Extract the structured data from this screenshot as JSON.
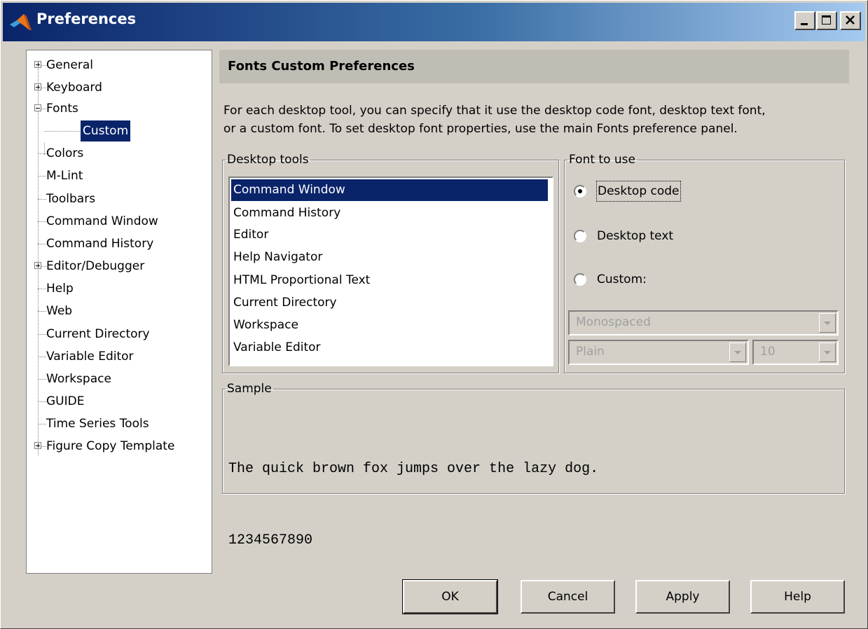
{
  "window": {
    "title": "Preferences"
  },
  "tree": {
    "items": [
      {
        "label": "General"
      },
      {
        "label": "Keyboard"
      },
      {
        "label": "Fonts"
      },
      {
        "label": "Custom"
      },
      {
        "label": "Colors"
      },
      {
        "label": "M-Lint"
      },
      {
        "label": "Toolbars"
      },
      {
        "label": "Command Window"
      },
      {
        "label": "Command History"
      },
      {
        "label": "Editor/Debugger"
      },
      {
        "label": "Help"
      },
      {
        "label": "Web"
      },
      {
        "label": "Current Directory"
      },
      {
        "label": "Variable Editor"
      },
      {
        "label": "Workspace"
      },
      {
        "label": "GUIDE"
      },
      {
        "label": "Time Series Tools"
      },
      {
        "label": "Figure Copy Template"
      }
    ],
    "selected": "Custom"
  },
  "panel": {
    "title": "Fonts Custom Preferences",
    "description_line1": "For each desktop tool, you can specify that it use the desktop code font, desktop text font,",
    "description_line2": "or a custom font.  To set desktop font properties, use the main Fonts preference panel."
  },
  "desktop_tools": {
    "legend": "Desktop tools",
    "items": [
      "Command Window",
      "Command History",
      "Editor",
      "Help Navigator",
      "HTML Proportional Text",
      "Current Directory",
      "Workspace",
      "Variable Editor"
    ],
    "selected": "Command Window"
  },
  "font_to_use": {
    "legend": "Font to use",
    "options": [
      "Desktop code",
      "Desktop text",
      "Custom:"
    ],
    "selected": "Desktop code",
    "font_family": "Monospaced",
    "font_style": "Plain",
    "font_size": "10"
  },
  "sample": {
    "legend": "Sample",
    "line1": "The quick brown fox jumps over the lazy dog.",
    "line2": "1234567890"
  },
  "buttons": {
    "ok": "OK",
    "cancel": "Cancel",
    "apply": "Apply",
    "help": "Help"
  }
}
